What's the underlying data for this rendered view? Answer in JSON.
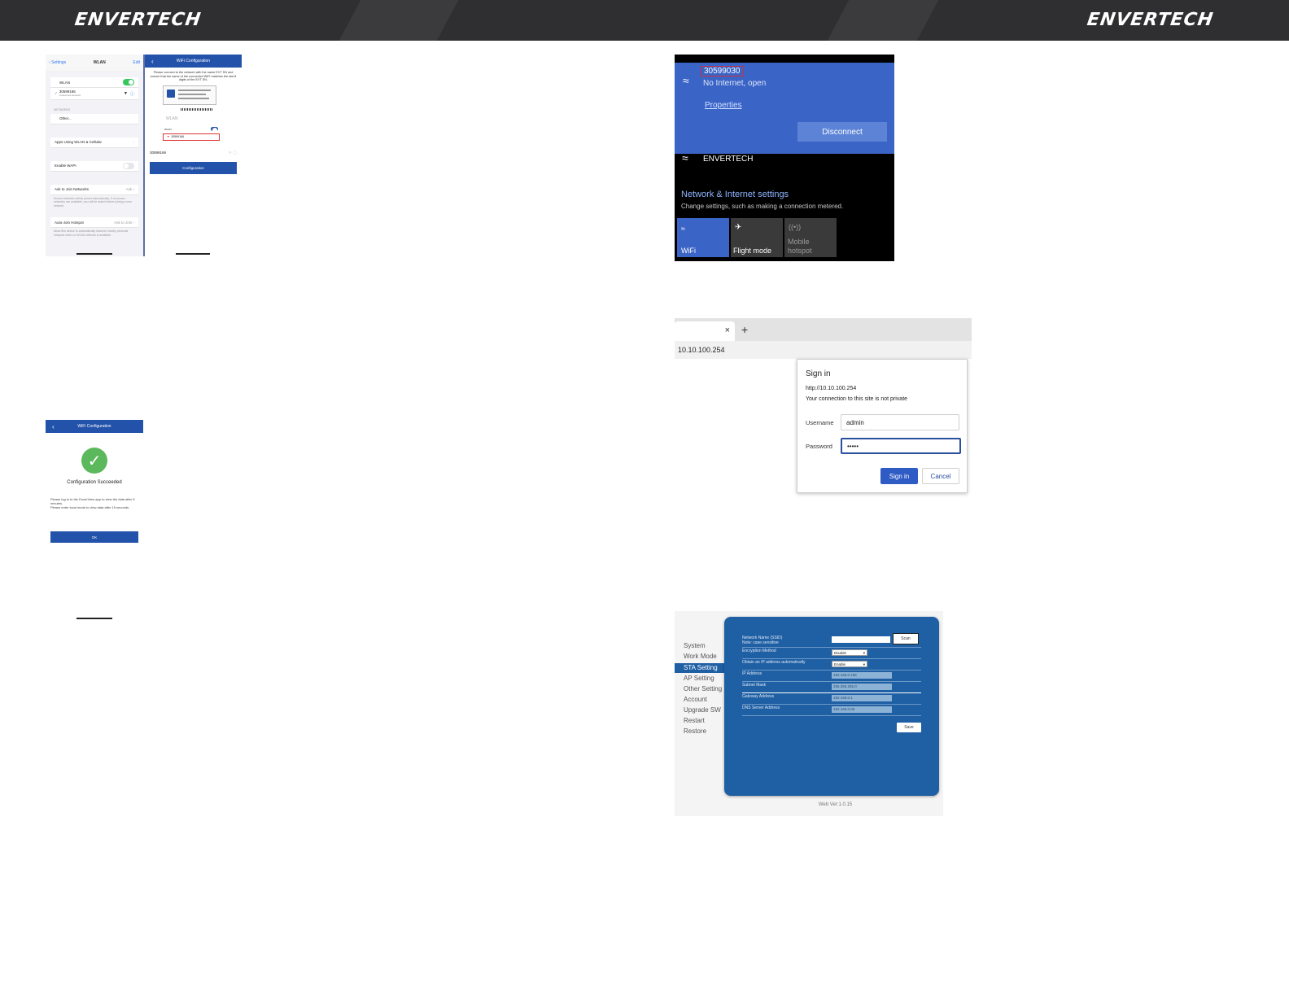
{
  "header": {
    "logo_left": "ENVERTECH",
    "logo_right": "ENVERTECH"
  },
  "ios_wlan": {
    "back": "Settings",
    "title": "WLAN",
    "edit": "Edit",
    "wlan_label": "WLAN",
    "connected_ssid": "30599166",
    "connected_sub": "Unsecured Network",
    "networks_header": "NETWORKS",
    "other": "Other...",
    "apps_using": "Apps Using WLAN & Cellular",
    "enable_wapi": "Enable WAPI",
    "ask_to_join": "Ask to Join Networks",
    "ask_value": "Ask",
    "ask_desc": "Known networks will be joined automatically. If no known networks are available, you will be asked before joining a new network.",
    "auto_join": "Auto-Join Hotspot",
    "auto_join_value": "Ask to Join",
    "auto_join_desc": "Allow this device to automatically discover nearby personal hotspots when no WLAN network is available."
  },
  "wifi_config": {
    "title": "WiFi Configuration",
    "instructions": "Please connect to the network with the name EVT SN and ensure that the name of the connected WiFi matches the last 8 digits of the EVT SN.",
    "illus_wlan": "WLAN",
    "illus_wlan_small": "WLAN",
    "illus_ssid": "30599166",
    "ssid": "30599166",
    "button": "Configuration"
  },
  "config_success": {
    "title": "WiFi Configuration",
    "heading": "Configuration Succeeded",
    "msg1": "Please log in to the EnverView app to view the data after 5 minutes.",
    "msg2": "Please enter local mode to view data after 15 seconds.",
    "ok": "OK"
  },
  "win_network": {
    "ssid": "30599030",
    "status": "No Internet, open",
    "properties": "Properties",
    "disconnect": "Disconnect",
    "other_network": "ENVERTECH",
    "settings_title": "Network & Internet settings",
    "settings_desc": "Change settings, such as making a connection metered.",
    "tiles": [
      "WiFi",
      "Flight mode",
      "Mobile hotspot"
    ]
  },
  "browser": {
    "close": "×",
    "newtab": "+",
    "address": "10.10.100.254",
    "dialog_title": "Sign in",
    "dialog_url": "http://10.10.100.254",
    "dialog_warning": "Your connection to this site is not private",
    "username_label": "Username",
    "username_value": "admin",
    "password_label": "Password",
    "password_value": "•••••",
    "sign_in": "Sign in",
    "cancel": "Cancel"
  },
  "router": {
    "menu": [
      "System",
      "Work Mode",
      "STA Setting",
      "AP Setting",
      "Other Setting",
      "Account",
      "Upgrade SW",
      "Restart",
      "Restore"
    ],
    "ssid_label": "Network Name (SSID)",
    "ssid_note": "Note: case sensitive",
    "scan": "Scan",
    "encryption_label": "Encryption Method",
    "encryption_value": "Disable",
    "dhcp_label": "Obtain an IP address automatically",
    "dhcp_value": "Enable",
    "ip_label": "IP Address",
    "ip_value": "192.168.0.155",
    "mask_label": "Subnet Mask",
    "mask_value": "255.255.255.0",
    "gateway_label": "Gateway Address",
    "gateway_value": "192.168.0.1",
    "dns_label": "DNS Server Address",
    "dns_value": "192.168.0.06",
    "save": "Save",
    "version": "Web Ver:1.0.15"
  },
  "colors": {
    "header": "#2f2f31",
    "ios_blue": "#2252aa",
    "win_blue": "#3b64c7",
    "router_blue": "#1f5fa4",
    "success_green": "#5cb85c"
  }
}
